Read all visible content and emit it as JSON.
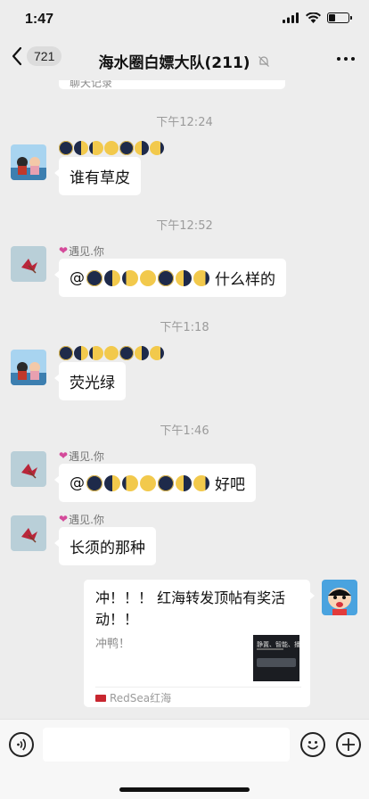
{
  "status_bar": {
    "time": "1:47",
    "battery_level": 0.35
  },
  "nav": {
    "back_count": "721",
    "title": "海水圈白嫖大队(211)",
    "muted": true
  },
  "previous_message_partial": "聊天记录",
  "messages": [
    {
      "time": "下午12:24",
      "sender": "moon-phases",
      "text": "谁有草皮"
    },
    {
      "time": "下午12:52",
      "sender_name": "遇见.你",
      "text": "什么样的",
      "mention": "@"
    },
    {
      "time": "下午1:18",
      "sender": "moon-phases",
      "text": "荧光绿"
    },
    {
      "time": "下午1:46",
      "sender_name": "遇见.你",
      "text": "好吧",
      "mention": "@"
    },
    {
      "sender_name": "遇见.你",
      "text": "长须的那种"
    }
  ],
  "card": {
    "title": "冲！！！ 红海转发顶帖有奖活动！！",
    "description": "冲鸭！",
    "thumb_text": "静置、智能、播控",
    "source": "RedSea红海"
  },
  "moon_icons": [
    "new-moon",
    "first-quarter-moon",
    "waxing-gibbous-moon",
    "full-moon",
    "new-moon",
    "first-quarter-moon",
    "waxing-gibbous-moon"
  ],
  "colors": {
    "background": "#ededed",
    "bubble": "#ffffff",
    "time_text": "#9b9b9b"
  },
  "input": {
    "value": ""
  }
}
